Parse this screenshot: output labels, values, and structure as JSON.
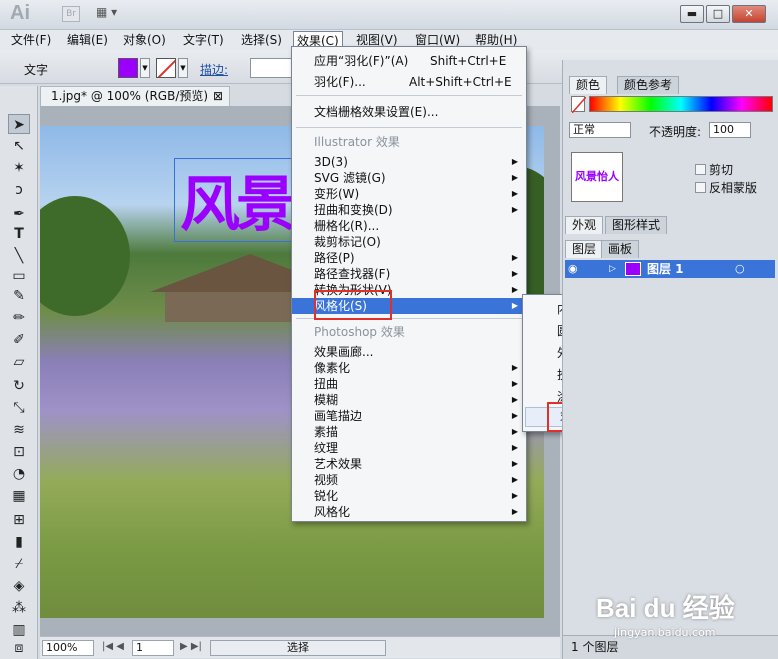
{
  "titlebar": {
    "app_logo": "Ai",
    "bridge_button": "Br",
    "layout_icon": "▦ ▾",
    "min": "▬",
    "max": "□",
    "close": "✕"
  },
  "menubar": [
    {
      "label": "文件(F)"
    },
    {
      "label": "编辑(E)"
    },
    {
      "label": "对象(O)"
    },
    {
      "label": "文字(T)"
    },
    {
      "label": "选择(S)"
    },
    {
      "label": "效果(C)"
    },
    {
      "label": "视图(V)"
    },
    {
      "label": "窗口(W)"
    },
    {
      "label": "帮助(H)"
    }
  ],
  "control": {
    "tool_label": "文字",
    "stroke_label": "描边:",
    "fill_color": "#9b00ff"
  },
  "document": {
    "tab_title": "1.jpg* @ 100% (RGB/预览)",
    "close": "⊠",
    "art_text": "风景怡人"
  },
  "statusbar": {
    "zoom": "100%",
    "page": "1",
    "mode": "选择"
  },
  "effect_menu": {
    "apply_last": {
      "label": "应用“羽化(F)”(A)",
      "shortcut": "Shift+Ctrl+E"
    },
    "last_effect": {
      "label": "羽化(F)...",
      "shortcut": "Alt+Shift+Ctrl+E"
    },
    "raster_settings": "文档栅格效果设置(E)...",
    "illustrator_header": "Illustrator 效果",
    "illustrator_items": [
      {
        "label": "3D(3)",
        "sub": true
      },
      {
        "label": "SVG 滤镜(G)",
        "sub": true
      },
      {
        "label": "变形(W)",
        "sub": true
      },
      {
        "label": "扭曲和变换(D)",
        "sub": true
      },
      {
        "label": "栅格化(R)...",
        "sub": false
      },
      {
        "label": "裁剪标记(O)",
        "sub": false
      },
      {
        "label": "路径(P)",
        "sub": true
      },
      {
        "label": "路径查找器(F)",
        "sub": true
      },
      {
        "label": "转换为形状(V)",
        "sub": true
      },
      {
        "label": "风格化(S)",
        "sub": true
      }
    ],
    "photoshop_header": "Photoshop 效果",
    "photoshop_items": [
      {
        "label": "效果画廊...",
        "sub": false
      },
      {
        "label": "像素化",
        "sub": true
      },
      {
        "label": "扭曲",
        "sub": true
      },
      {
        "label": "模糊",
        "sub": true
      },
      {
        "label": "画笔描边",
        "sub": true
      },
      {
        "label": "素描",
        "sub": true
      },
      {
        "label": "纹理",
        "sub": true
      },
      {
        "label": "艺术效果",
        "sub": true
      },
      {
        "label": "视频",
        "sub": true
      },
      {
        "label": "锐化",
        "sub": true
      },
      {
        "label": "风格化",
        "sub": true
      }
    ]
  },
  "stylize_submenu": [
    {
      "label": "内发光(I)..."
    },
    {
      "label": "圆角(R)..."
    },
    {
      "label": "外发光(O)..."
    },
    {
      "label": "投影(D)..."
    },
    {
      "label": "涂抹(B)..."
    },
    {
      "label": "羽化(F)..."
    }
  ],
  "panels": {
    "color_tab": "颜色",
    "color_guide_tab": "颜色参考",
    "blend_mode": "正常",
    "opacity_label": "不透明度:",
    "opacity_value": "100",
    "clip_label": "剪切",
    "invert_mask_label": "反相蒙版",
    "appearance_tab": "外观",
    "graphic_styles_tab": "图形样式",
    "layers_tab": "图层",
    "artboards_tab": "画板",
    "layer_name": "图层 1",
    "layers_count": "1 个图层"
  },
  "watermark": {
    "brand": "Bai du 经验",
    "url": "jingyan.baidu.com"
  },
  "highlight_color": "#e0302a",
  "selection_color": "#3a74d8"
}
